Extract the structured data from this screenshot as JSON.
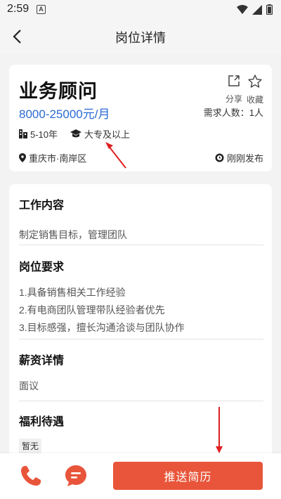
{
  "status_bar": {
    "time": "2:59",
    "notification": "A"
  },
  "header": {
    "title": "岗位详情"
  },
  "job": {
    "title": "业务顾问",
    "salary": "8000-25000元/月",
    "share_label": "分享",
    "favorite_label": "收藏",
    "headcount": "需求人数：1人",
    "experience": "5-10年",
    "education": "大专及以上",
    "location": "重庆市·南岸区",
    "posted": "刚刚发布"
  },
  "sections": {
    "content": {
      "title": "工作内容",
      "text": "制定销售目标，管理团队"
    },
    "requirements": {
      "title": "岗位要求",
      "items": [
        "1.具备销售相关工作经验",
        "2.有电商团队管理带队经验者优先",
        "3.目标感强，擅长沟通洽谈与团队协作"
      ]
    },
    "salary_detail": {
      "title": "薪资详情",
      "text": "面议"
    },
    "benefits": {
      "title": "福利待遇",
      "tag": "暂无"
    }
  },
  "bottom_bar": {
    "apply_label": "推送简历"
  },
  "colors": {
    "accent": "#e8553a",
    "salary": "#2a6bd4",
    "annotation_arrow": "#e02020"
  }
}
